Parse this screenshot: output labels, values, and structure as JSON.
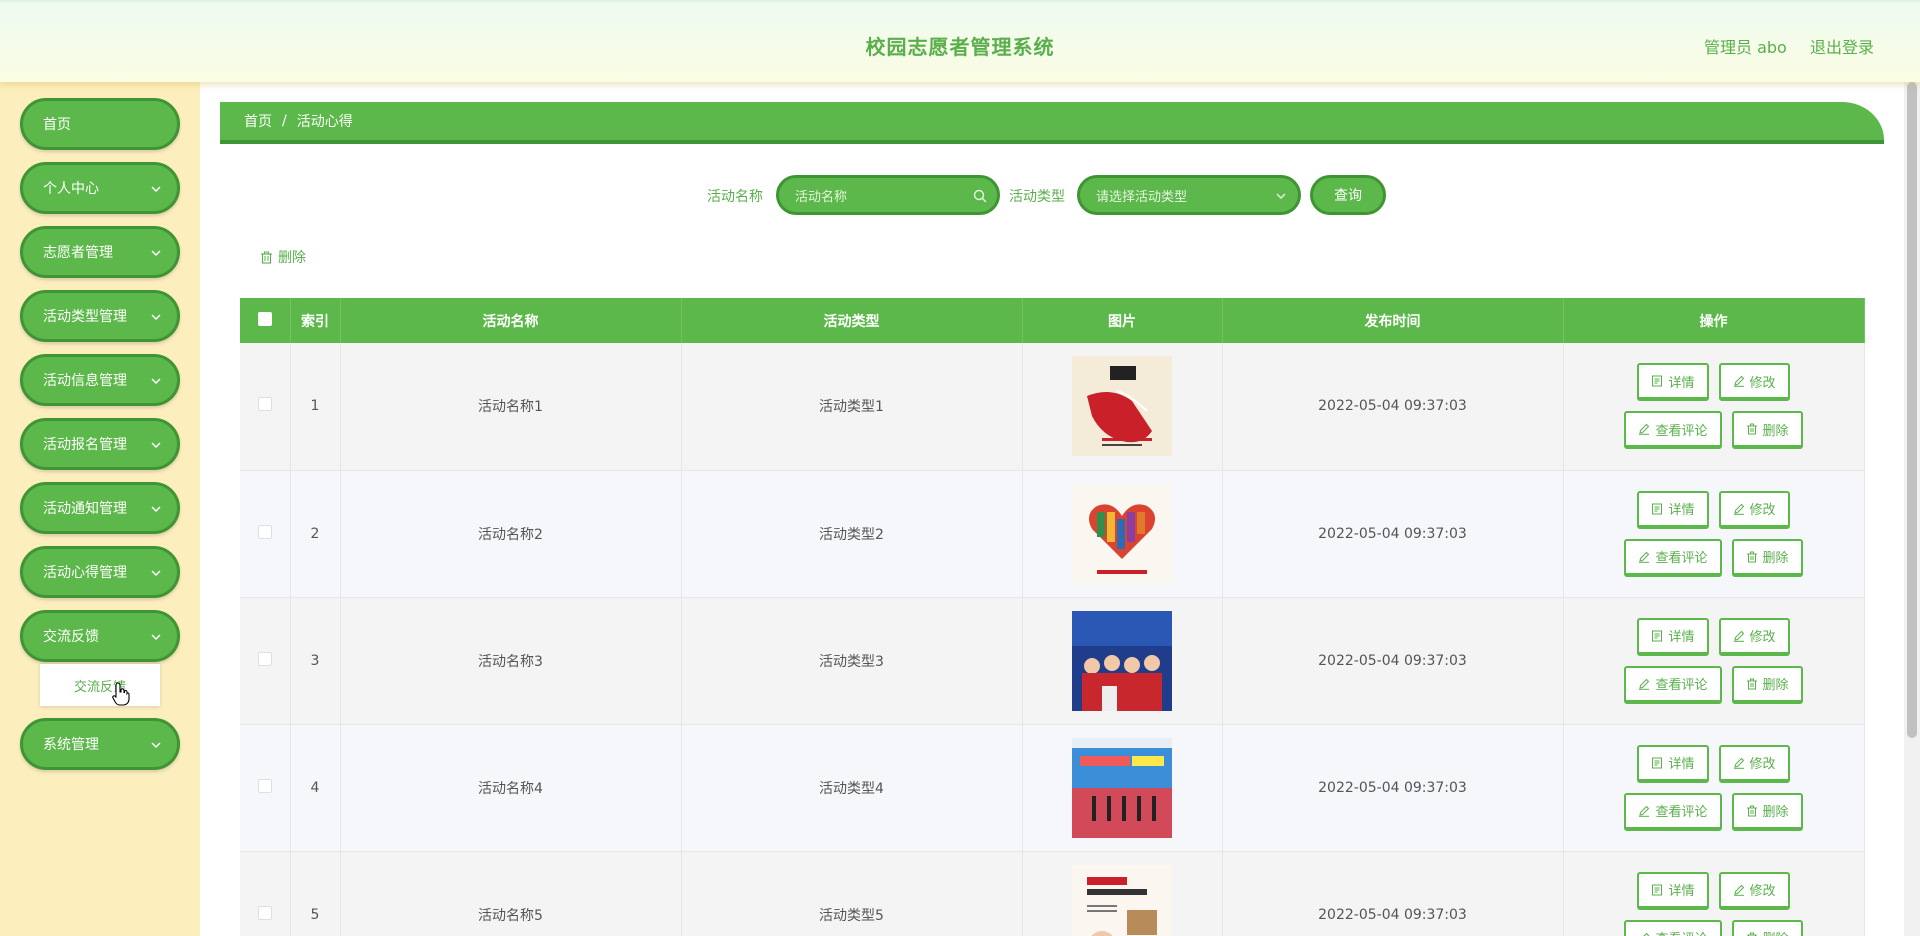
{
  "header": {
    "title": "校园志愿者管理系统",
    "user": "管理员 abo",
    "logout": "退出登录"
  },
  "sidebar": {
    "items": [
      {
        "label": "首页",
        "has_sub": false
      },
      {
        "label": "个人中心",
        "has_sub": true
      },
      {
        "label": "志愿者管理",
        "has_sub": true
      },
      {
        "label": "活动类型管理",
        "has_sub": true
      },
      {
        "label": "活动信息管理",
        "has_sub": true
      },
      {
        "label": "活动报名管理",
        "has_sub": true
      },
      {
        "label": "活动通知管理",
        "has_sub": true
      },
      {
        "label": "活动心得管理",
        "has_sub": true
      },
      {
        "label": "交流反馈",
        "has_sub": true
      },
      {
        "label": "系统管理",
        "has_sub": true
      }
    ],
    "open_submenu": {
      "label": "交流反馈"
    }
  },
  "breadcrumb": {
    "home": "首页",
    "separator": "/",
    "current": "活动心得"
  },
  "search": {
    "name_label": "活动名称",
    "name_placeholder": "活动名称",
    "type_label": "活动类型",
    "type_placeholder": "请选择活动类型",
    "query_button": "查询"
  },
  "toolbar": {
    "delete_label": "删除"
  },
  "table": {
    "columns": [
      "索引",
      "活动名称",
      "活动类型",
      "图片",
      "发布时间",
      "操作"
    ],
    "rows": [
      {
        "index": "1",
        "name": "活动名称1",
        "type": "活动类型1",
        "image": "poster-hands",
        "time": "2022-05-04 09:37:03"
      },
      {
        "index": "2",
        "name": "活动名称2",
        "type": "活动类型2",
        "image": "poster-heart-books",
        "time": "2022-05-04 09:37:03"
      },
      {
        "index": "3",
        "name": "活动名称3",
        "type": "活动类型3",
        "image": "photo-group",
        "time": "2022-05-04 09:37:03"
      },
      {
        "index": "4",
        "name": "活动名称4",
        "type": "活动类型4",
        "image": "photo-banner",
        "time": "2022-05-04 09:37:03"
      },
      {
        "index": "5",
        "name": "活动名称5",
        "type": "活动类型5",
        "image": "poster-book",
        "time": "2022-05-04 09:37:03"
      }
    ],
    "actions": {
      "detail": "详情",
      "edit": "修改",
      "comments": "查看评论",
      "delete": "删除"
    }
  },
  "colors": {
    "primary": "#5cb84a",
    "primary_dark": "#3f9433",
    "sidebar_bg": "#fdeebe",
    "text_green": "#5aaf4c"
  }
}
